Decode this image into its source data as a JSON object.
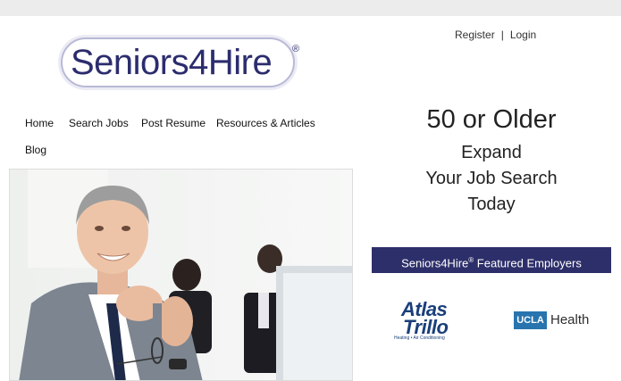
{
  "header": {
    "register_label": "Register",
    "separator": "|",
    "login_label": "Login"
  },
  "logo": {
    "text": "Seniors4Hire",
    "reg_mark": "®"
  },
  "nav": {
    "items": [
      {
        "label": "Home"
      },
      {
        "label": "Search Jobs"
      },
      {
        "label": "Post Resume"
      },
      {
        "label": "Resources & Articles"
      },
      {
        "label": "Blog"
      }
    ]
  },
  "promo": {
    "headline": "50 or Older",
    "line1": "Expand",
    "line2": "Your Job Search",
    "line3": "Today"
  },
  "featured": {
    "label_prefix": "Seniors4Hire",
    "reg_mark": "®",
    "label_suffix": " Featured Employers"
  },
  "employers": {
    "atlas_line1": "Atlas",
    "atlas_line2": "Trillo",
    "atlas_sub": "Heating • Air Conditioning",
    "ucla_box": "UCLA",
    "ucla_text": "Health"
  },
  "colors": {
    "brand_navy": "#2c2d6e",
    "featured_bar": "#2d2f6a",
    "ucla_blue": "#2774ae"
  }
}
